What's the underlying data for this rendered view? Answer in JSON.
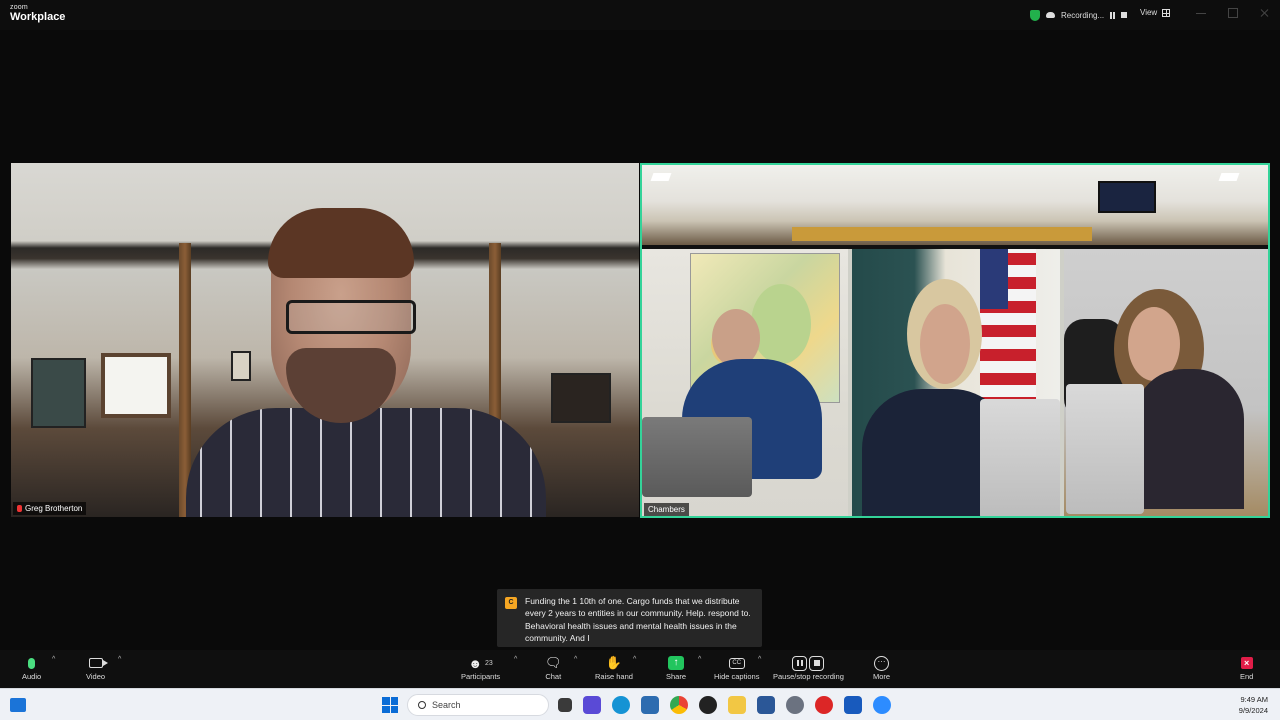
{
  "app": {
    "brand_small": "zoom",
    "brand_large": "Workplace",
    "recording_label": "Recording...",
    "view_label": "View"
  },
  "participants": {
    "left_tile_name": "Greg Brotherton",
    "right_tile_name": "Chambers"
  },
  "caption": {
    "text": "Funding the 1 10th of one. Cargo funds that we distribute every 2 years to entities in our community. Help. respond to. Behavioral health issues and mental health issues in the community. And I"
  },
  "toolbar": {
    "audio_label": "Audio",
    "video_label": "Video",
    "participants_label": "Participants",
    "participants_count": "23",
    "chat_label": "Chat",
    "raise_hand_label": "Raise hand",
    "share_label": "Share",
    "captions_label": "Hide captions",
    "recording_label": "Pause/stop recording",
    "more_label": "More",
    "end_label": "End"
  },
  "taskbar": {
    "search_placeholder": "Search",
    "time": "9:49 AM",
    "date": "9/9/2024"
  },
  "colors": {
    "active_speaker_border": "#34d399",
    "share_green": "#22c55e",
    "end_red": "#e11d48"
  }
}
